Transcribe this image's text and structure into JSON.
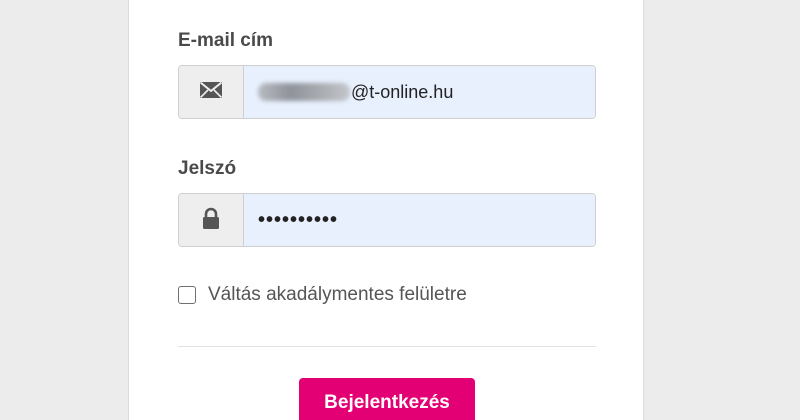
{
  "form": {
    "email": {
      "label": "E-mail cím",
      "value_suffix": "@t-online.hu",
      "icon": "envelope-icon"
    },
    "password": {
      "label": "Jelszó",
      "masked_value": "••••••••••",
      "icon": "lock-icon"
    },
    "accessibility_checkbox": {
      "label": "Váltás akadálymentes felületre",
      "checked": false
    },
    "login_button": {
      "label": "Bejelentkezés",
      "color": "#e20074"
    }
  }
}
